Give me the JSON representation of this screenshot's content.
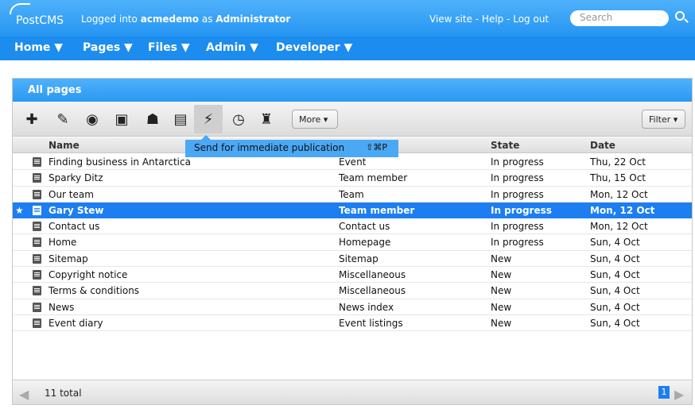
{
  "app": {
    "logo": "PostCMS",
    "login_prefix": "Logged into",
    "site": "acmedemo",
    "as": "as",
    "role": "Administrator",
    "links": "View site - Help - Log out",
    "search_placeholder": "Search"
  },
  "menu": [
    "Home ▼",
    "Pages ▼",
    "Files ▼",
    "Admin ▼",
    "Developer ▼"
  ],
  "panel": {
    "title": "All pages",
    "more_label": "More ▾",
    "filter_label": "Filter ▾",
    "tooltip": "Send for immediate publication",
    "tooltip_shortcut": "⇧⌘P"
  },
  "tools": [
    "add-icon",
    "edit-icon",
    "preview-icon",
    "comment-icon",
    "assign-user-icon",
    "lock-icon",
    "publish-icon",
    "schedule-icon",
    "delete-icon"
  ],
  "columns": {
    "name": "Name",
    "state": "State",
    "date": "Date"
  },
  "rows": [
    {
      "name": "Finding business in Antarctica",
      "type": "Event",
      "state": "In progress",
      "date": "Thu, 22 Oct"
    },
    {
      "name": "Sparky Ditz",
      "type": "Team member",
      "state": "In progress",
      "date": "Thu, 15 Oct"
    },
    {
      "name": "Our team",
      "type": "Team",
      "state": "In progress",
      "date": "Mon, 12 Oct"
    },
    {
      "name": "Gary Stew",
      "type": "Team member",
      "state": "In progress",
      "date": "Mon, 12 Oct"
    },
    {
      "name": "Contact us",
      "type": "Contact us",
      "state": "In progress",
      "date": "Mon, 12 Oct"
    },
    {
      "name": "Home",
      "type": "Homepage",
      "state": "In progress",
      "date": "Sun, 4 Oct"
    },
    {
      "name": "Sitemap",
      "type": "Sitemap",
      "state": "New",
      "date": "Sun, 4 Oct"
    },
    {
      "name": "Copyright notice",
      "type": "Miscellaneous",
      "state": "New",
      "date": "Sun, 4 Oct"
    },
    {
      "name": "Terms & conditions",
      "type": "Miscellaneous",
      "state": "New",
      "date": "Sun, 4 Oct"
    },
    {
      "name": "News",
      "type": "News index",
      "state": "New",
      "date": "Sun, 4 Oct"
    },
    {
      "name": "Event diary",
      "type": "Event listings",
      "state": "New",
      "date": "Sun, 4 Oct"
    }
  ],
  "footer": {
    "total": "11 total",
    "page": "1"
  },
  "colors": {
    "accent": "#2595f2",
    "selected": "#1c7ef0"
  }
}
